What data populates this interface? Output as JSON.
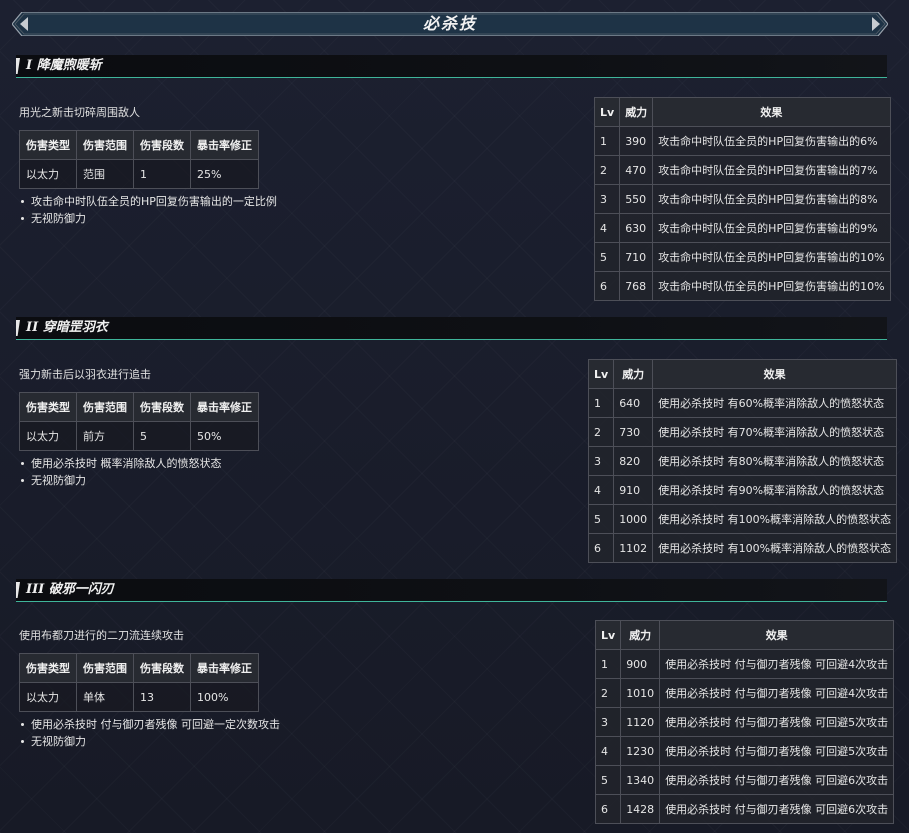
{
  "page": {
    "title": "必杀技"
  },
  "stat_headers": [
    "伤害类型",
    "伤害范围",
    "伤害段数",
    "暴击率修正"
  ],
  "level_headers": [
    "Lv",
    "威力",
    "效果"
  ],
  "skills": [
    {
      "title": "I 降魔煦暖斩",
      "description": "用光之新击切碎周围敌人",
      "stats": [
        "以太力",
        "范围",
        "1",
        "25%"
      ],
      "notes": [
        "攻击命中时队伍全员的HP回复伤害输出的一定比例",
        "无视防御力"
      ],
      "levels": [
        {
          "lv": "1",
          "power": "390",
          "effect": "攻击命中时队伍全员的HP回复伤害输出的6%"
        },
        {
          "lv": "2",
          "power": "470",
          "effect": "攻击命中时队伍全员的HP回复伤害输出的7%"
        },
        {
          "lv": "3",
          "power": "550",
          "effect": "攻击命中时队伍全员的HP回复伤害输出的8%"
        },
        {
          "lv": "4",
          "power": "630",
          "effect": "攻击命中时队伍全员的HP回复伤害输出的9%"
        },
        {
          "lv": "5",
          "power": "710",
          "effect": "攻击命中时队伍全员的HP回复伤害输出的10%"
        },
        {
          "lv": "6",
          "power": "768",
          "effect": "攻击命中时队伍全员的HP回复伤害输出的10%"
        }
      ]
    },
    {
      "title": "II 穿暗罡羽衣",
      "description": "强力新击后以羽衣进行追击",
      "stats": [
        "以太力",
        "前方",
        "5",
        "50%"
      ],
      "notes": [
        "使用必杀技时 概率消除敌人的愤怒状态",
        "无视防御力"
      ],
      "levels": [
        {
          "lv": "1",
          "power": "640",
          "effect": "使用必杀技时 有60%概率消除敌人的愤怒状态"
        },
        {
          "lv": "2",
          "power": "730",
          "effect": "使用必杀技时 有70%概率消除敌人的愤怒状态"
        },
        {
          "lv": "3",
          "power": "820",
          "effect": "使用必杀技时 有80%概率消除敌人的愤怒状态"
        },
        {
          "lv": "4",
          "power": "910",
          "effect": "使用必杀技时 有90%概率消除敌人的愤怒状态"
        },
        {
          "lv": "5",
          "power": "1000",
          "effect": "使用必杀技时 有100%概率消除敌人的愤怒状态"
        },
        {
          "lv": "6",
          "power": "1102",
          "effect": "使用必杀技时 有100%概率消除敌人的愤怒状态"
        }
      ]
    },
    {
      "title": "III 破邪一闪刃",
      "description": "使用布都刀进行的二刀流连续攻击",
      "stats": [
        "以太力",
        "单体",
        "13",
        "100%"
      ],
      "notes": [
        "使用必杀技时 付与御刃者残像 可回避一定次数攻击",
        "无视防御力"
      ],
      "levels": [
        {
          "lv": "1",
          "power": "900",
          "effect": "使用必杀技时 付与御刃者残像 可回避4次攻击"
        },
        {
          "lv": "2",
          "power": "1010",
          "effect": "使用必杀技时 付与御刃者残像 可回避4次攻击"
        },
        {
          "lv": "3",
          "power": "1120",
          "effect": "使用必杀技时 付与御刃者残像 可回避5次攻击"
        },
        {
          "lv": "4",
          "power": "1230",
          "effect": "使用必杀技时 付与御刃者残像 可回避5次攻击"
        },
        {
          "lv": "5",
          "power": "1340",
          "effect": "使用必杀技时 付与御刃者残像 可回避6次攻击"
        },
        {
          "lv": "6",
          "power": "1428",
          "effect": "使用必杀技时 付与御刃者残像 可回避6次攻击"
        }
      ]
    }
  ]
}
